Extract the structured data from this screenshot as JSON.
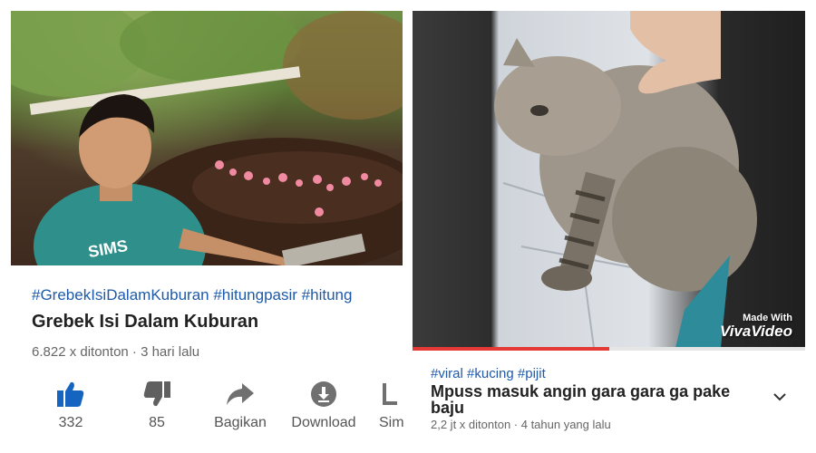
{
  "left_video": {
    "hashtags": "#GrebekIsiDalamKuburan #hitungpasir #hitung",
    "title": "Grebek Isi Dalam Kuburan",
    "meta": "6.822 x ditonton · 3 hari lalu",
    "thumbnail_text": "SIMS",
    "actions": {
      "like_count": "332",
      "dislike_count": "85",
      "share_label": "Bagikan",
      "download_label": "Download",
      "save_label": "Sim"
    }
  },
  "right_video": {
    "hashtags": "#viral #kucing #pijit",
    "title": "Mpuss masuk angin gara gara ga pake baju",
    "meta": "2,2 jt x ditonton · 4 tahun yang lalu",
    "watermark_top": "Made With",
    "watermark_bottom": "VivaVideo",
    "progress_fraction": 0.5,
    "expand_icon": "chevron-down-icon"
  },
  "colors": {
    "hashtag": "#1e5aa8",
    "like_active": "#1565c0",
    "progress": "#e53935"
  }
}
